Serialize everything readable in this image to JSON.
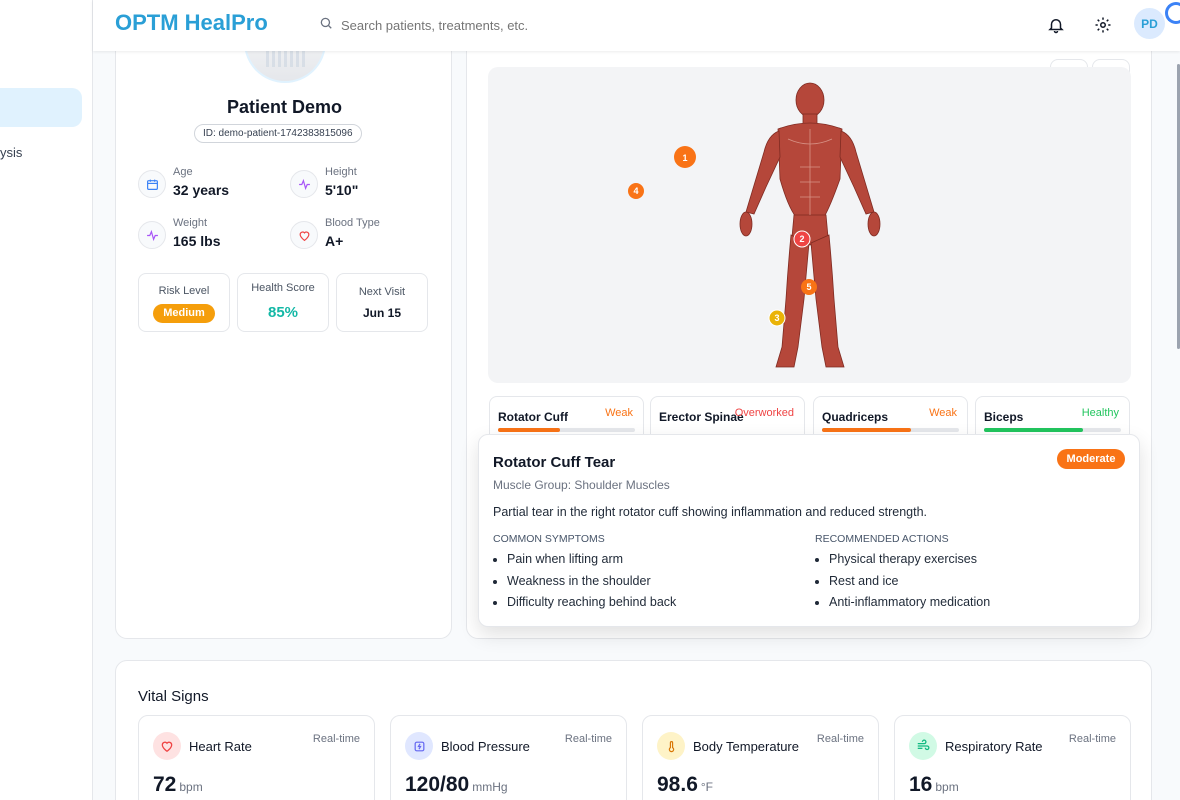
{
  "app": {
    "brand": "OPTM HealPro",
    "search_placeholder": "Search patients, treatments, etc.",
    "user_initials": "PD"
  },
  "sidebar": {
    "partial_item": "ysis"
  },
  "patient": {
    "name": "Patient Demo",
    "id": "ID: demo-patient-1742383815096",
    "age_label": "Age",
    "age": "32 years",
    "height_label": "Height",
    "height": "5'10\"",
    "weight_label": "Weight",
    "weight": "165 lbs",
    "blood_label": "Blood Type",
    "blood": "A+",
    "risk_label": "Risk Level",
    "risk": "Medium",
    "score_label": "Health Score",
    "score": "85%",
    "visit_label": "Next Visit",
    "visit": "Jun 15"
  },
  "markers": [
    "1",
    "2",
    "3",
    "4",
    "5"
  ],
  "muscles": [
    {
      "name": "Rotator Cuff",
      "status": "Weak",
      "color": "#f97316",
      "level": 0.45
    },
    {
      "name": "Erector Spinae",
      "status": "Overworked",
      "color": "#ef4444",
      "level": 0.7
    },
    {
      "name": "Quadriceps",
      "status": "Weak",
      "color": "#f97316",
      "level": 0.65
    },
    {
      "name": "Biceps",
      "status": "Healthy",
      "color": "#22c55e",
      "level": 0.72
    }
  ],
  "detail": {
    "title": "Rotator Cuff Tear",
    "group": "Muscle Group: Shoulder Muscles",
    "severity": "Moderate",
    "description": "Partial tear in the right rotator cuff showing inflammation and reduced strength.",
    "symptoms_heading": "COMMON SYMPTOMS",
    "symptoms": [
      "Pain when lifting arm",
      "Weakness in the shoulder",
      "Difficulty reaching behind back"
    ],
    "actions_heading": "RECOMMENDED ACTIONS",
    "actions": [
      "Physical therapy exercises",
      "Rest and ice",
      "Anti-inflammatory medication"
    ]
  },
  "vitals": {
    "title": "Vital Signs",
    "items": [
      {
        "name": "Heart Rate",
        "tag": "Real-time",
        "value": "72",
        "unit": "bpm",
        "icon": "heart-icon"
      },
      {
        "name": "Blood Pressure",
        "tag": "Real-time",
        "value": "120/80",
        "unit": "mmHg",
        "icon": "activity-icon"
      },
      {
        "name": "Body Temperature",
        "tag": "Real-time",
        "value": "98.6",
        "unit": "°F",
        "icon": "thermometer-icon"
      },
      {
        "name": "Respiratory Rate",
        "tag": "Real-time",
        "value": "16",
        "unit": "bpm",
        "icon": "wind-icon"
      }
    ]
  }
}
